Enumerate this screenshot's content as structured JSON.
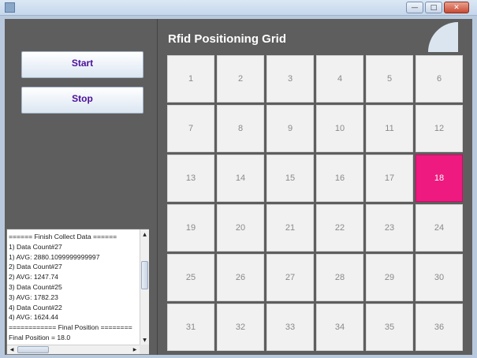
{
  "window": {
    "minimize_glyph": "—",
    "maximize_glyph": "□",
    "close_glyph": "✕"
  },
  "controls": {
    "start_label": "Start",
    "stop_label": "Stop"
  },
  "log": {
    "lines": [
      "====== Finish Collect Data ======",
      "1) Data Count#27",
      "1) AVG: 2880.1099999999997",
      "2) Data Count#27",
      "2) AVG: 1247.74",
      "3) Data Count#25",
      "3) AVG: 1782.23",
      "4) Data Count#22",
      "4) AVG: 1624.44",
      "============ Final Position ========",
      "Final Position = 18.0"
    ],
    "scroll_up_glyph": "▲",
    "scroll_down_glyph": "▼",
    "scroll_left_glyph": "◀",
    "scroll_right_glyph": "▶"
  },
  "grid": {
    "title": "Rfid Positioning Grid",
    "cells": [
      "1",
      "2",
      "3",
      "4",
      "5",
      "6",
      "7",
      "8",
      "9",
      "10",
      "11",
      "12",
      "13",
      "14",
      "15",
      "16",
      "17",
      "18",
      "19",
      "20",
      "21",
      "22",
      "23",
      "24",
      "25",
      "26",
      "27",
      "28",
      "29",
      "30",
      "31",
      "32",
      "33",
      "34",
      "35",
      "36"
    ],
    "active_cell": "18",
    "active_color": "#ee1a7f"
  }
}
